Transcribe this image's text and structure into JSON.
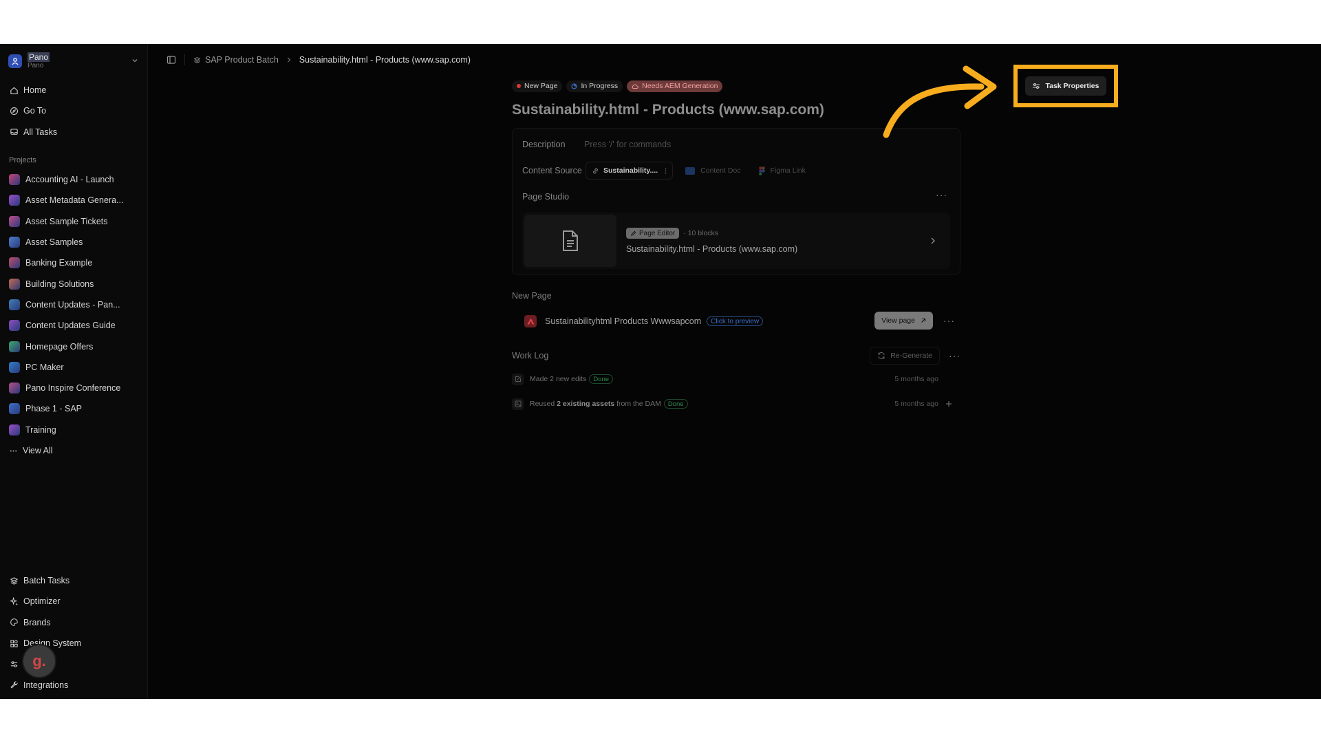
{
  "workspace": {
    "name": "Pano",
    "sub": "Pano"
  },
  "nav": [
    {
      "label": "Home",
      "icon": "home-icon"
    },
    {
      "label": "Go To",
      "icon": "compass-icon"
    },
    {
      "label": "All Tasks",
      "icon": "inbox-icon"
    }
  ],
  "projects_label": "Projects",
  "projects": [
    {
      "label": "Accounting AI - Launch",
      "color": "#c8447a"
    },
    {
      "label": "Asset Metadata Genera...",
      "color": "#9b4fc9"
    },
    {
      "label": "Asset Sample Tickets",
      "color": "#c04e8a"
    },
    {
      "label": "Asset Samples",
      "color": "#4d7fcc"
    },
    {
      "label": "Banking Example",
      "color": "#c24d6a"
    },
    {
      "label": "Building Solutions",
      "color": "#c96a4f"
    },
    {
      "label": "Content Updates - Pan...",
      "color": "#3f7fb8"
    },
    {
      "label": "Content Updates Guide",
      "color": "#8e4fc2"
    },
    {
      "label": "Homepage Offers",
      "color": "#3fa86a"
    },
    {
      "label": "PC Maker",
      "color": "#2f7fc9"
    },
    {
      "label": "Pano Inspire Conference",
      "color": "#b84f8a"
    },
    {
      "label": "Phase 1 - SAP",
      "color": "#3f6fc9"
    },
    {
      "label": "Training",
      "color": "#9b4fc9"
    }
  ],
  "view_all": "View All",
  "bottom_nav": [
    {
      "label": "Batch Tasks",
      "icon": "layers-icon"
    },
    {
      "label": "Optimizer",
      "icon": "sparkle-icon"
    },
    {
      "label": "Brands",
      "icon": "palette-icon"
    },
    {
      "label": "Design System",
      "icon": "components-icon"
    },
    {
      "label": "",
      "icon": "sliders-icon"
    },
    {
      "label": "Integrations",
      "icon": "wrench-icon"
    }
  ],
  "user_avatar": "g.",
  "breadcrumb": {
    "parent": "SAP Product Batch",
    "current": "Sustainability.html - Products (www.sap.com)"
  },
  "badges": {
    "new_page": "New Page",
    "in_progress": "In Progress",
    "needs_aem": "Needs AEM Generation"
  },
  "title": "Sustainability.html - Products (www.sap.com)",
  "description": {
    "label": "Description",
    "placeholder": "Press '/' for commands"
  },
  "content_source": {
    "label": "Content Source",
    "chip": "Sustainability....",
    "content_doc": "Content Doc",
    "figma_link": "Figma Link"
  },
  "page_studio": {
    "label": "Page Studio",
    "tag": "Page Editor",
    "meta": "10 blocks",
    "title": "Sustainability.html - Products (www.sap.com)"
  },
  "new_page_section": {
    "label": "New Page",
    "title": "Sustainabilityhtml Products Wwwsapcom",
    "preview": "Click to preview",
    "view_button": "View page"
  },
  "work_log": {
    "label": "Work Log",
    "regenerate": "Re-Generate",
    "entries": [
      {
        "pre": "Made 2 new edits",
        "strong": "",
        "post": "",
        "status": "Done",
        "time": "5 months ago"
      },
      {
        "pre": "Reused ",
        "strong": "2 existing assets",
        "post": " from the DAM",
        "status": "Done",
        "time": "5 months ago"
      }
    ]
  },
  "task_properties": "Task Properties",
  "colors": {
    "highlight": "#f8ad1f",
    "background": "#050505"
  }
}
